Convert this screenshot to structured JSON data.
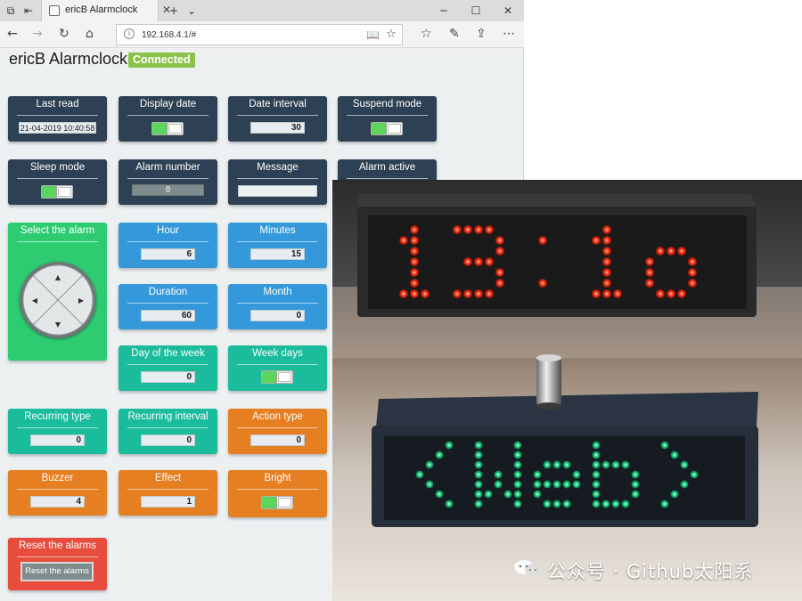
{
  "browser": {
    "tab_title": "ericB Alarmclock",
    "url": "192.168.4.1/#",
    "icons": [
      "back-icon",
      "forward-icon",
      "refresh-icon",
      "home-icon",
      "reading-view-icon",
      "favorite-star-icon",
      "favorites-list-icon",
      "notes-pen-icon",
      "share-icon",
      "more-icon"
    ]
  },
  "app": {
    "title": "ericB Alarmclock",
    "status": "Connected",
    "colors": {
      "dark": "#2e4053",
      "blue": "#3498db",
      "teal": "#1abc9c",
      "orange": "#e67e22",
      "green": "#2ecc71",
      "red": "#e74c3c",
      "badge": "#8bc34a"
    }
  },
  "tiles": {
    "last_read": {
      "label": "Last read",
      "value": "21-04-2019 10:40:58"
    },
    "display_date": {
      "label": "Display date",
      "on": true
    },
    "date_interval": {
      "label": "Date interval",
      "value": "30"
    },
    "suspend_mode": {
      "label": "Suspend mode",
      "on": true
    },
    "sleep_mode": {
      "label": "Sleep mode",
      "on": true
    },
    "alarm_number": {
      "label": "Alarm number",
      "value": "0"
    },
    "message": {
      "label": "Message",
      "value": ""
    },
    "alarm_active": {
      "label": "Alarm active"
    },
    "select_alarm": {
      "label": "Select the alarm",
      "arrows": [
        "▲",
        "◀",
        "▶",
        "▼"
      ]
    },
    "hour": {
      "label": "Hour",
      "value": "6"
    },
    "minutes": {
      "label": "Minutes",
      "value": "15"
    },
    "duration": {
      "label": "Duration",
      "value": "60"
    },
    "month": {
      "label": "Month",
      "value": "0"
    },
    "day_of_week": {
      "label": "Day of the week",
      "value": "0"
    },
    "week_days": {
      "label": "Week days",
      "on": true
    },
    "recurring_type": {
      "label": "Recurring type",
      "value": "0"
    },
    "recurring_interval": {
      "label": "Recurring interval",
      "value": "0"
    },
    "action_type": {
      "label": "Action type",
      "value": "0"
    },
    "buzzer": {
      "label": "Buzzer",
      "value": "4"
    },
    "effect": {
      "label": "Effect",
      "value": "1"
    },
    "bright": {
      "label": "Bright",
      "on": true
    },
    "reset": {
      "label": "Reset the alarms",
      "button": "Reset the alarms"
    }
  },
  "photo": {
    "top_display": "13:10",
    "bottom_display": "<Web>",
    "watermark": "公众号 · Github太阳系",
    "led_colors": {
      "red": "#ff3b1f",
      "green": "#23d58a"
    }
  }
}
